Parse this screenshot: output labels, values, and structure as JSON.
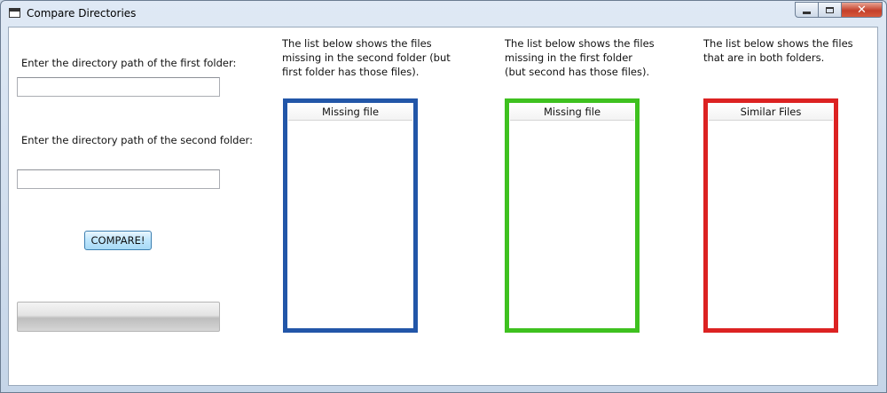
{
  "window": {
    "title": "Compare Directories",
    "close_glyph": "✕"
  },
  "left_panel": {
    "first_folder_label": "Enter the directory path of the first folder:",
    "first_folder_value": "",
    "second_folder_label": "Enter the directory path of the second folder:",
    "second_folder_value": "",
    "compare_label": "COMPARE!",
    "progress_fraction": 0
  },
  "lists": [
    {
      "description": "The list below shows the files missing in the second folder (but first folder has those files).",
      "header": "Missing file",
      "border_color": "#2256a8",
      "items": []
    },
    {
      "description": "The list below shows the files missing in the first folder (but second has those files).",
      "header": "Missing file",
      "border_color": "#3ec11f",
      "items": []
    },
    {
      "description": "The list below shows the files that are in both folders.",
      "header": "Similar Files",
      "border_color": "#dc2222",
      "items": []
    }
  ]
}
